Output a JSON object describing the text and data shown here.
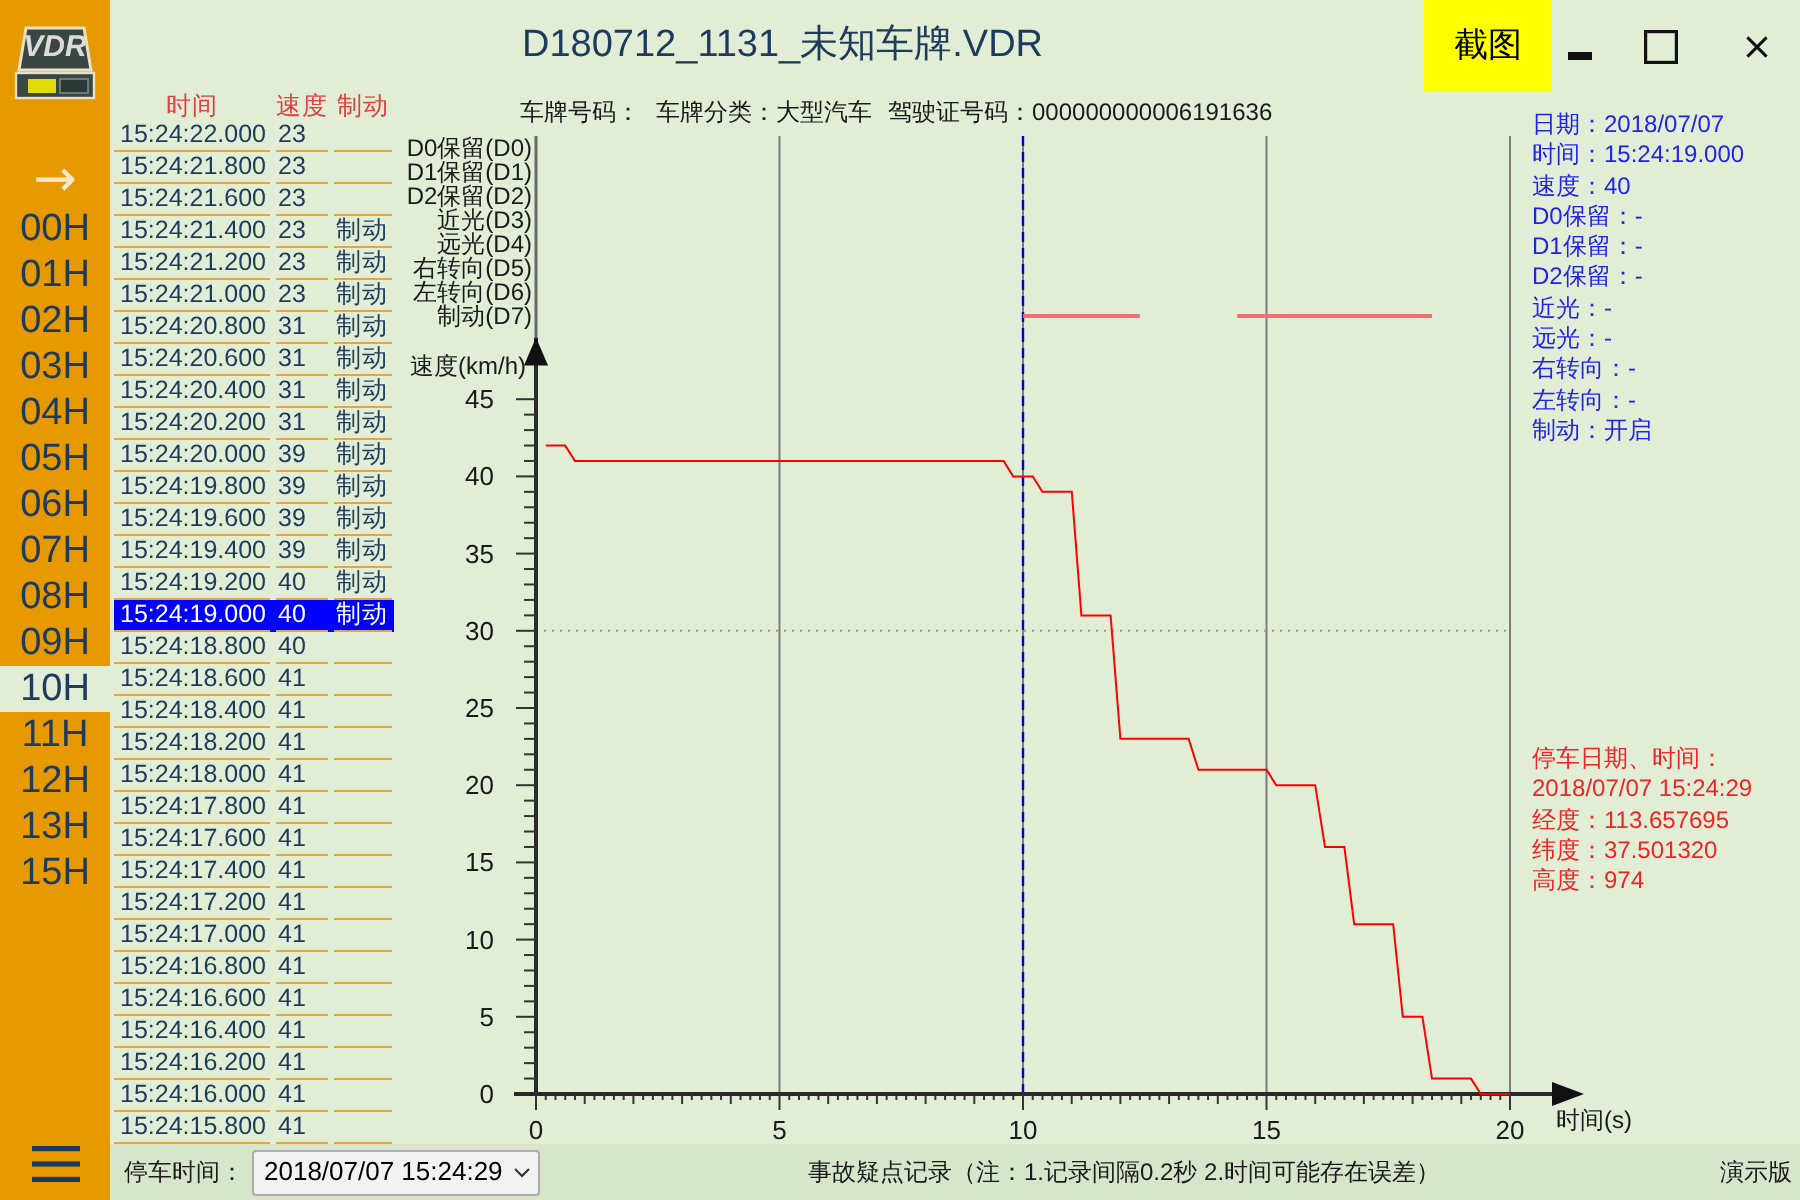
{
  "sidebar": {
    "logo_text": "VDR",
    "arrow": "→",
    "hours": [
      {
        "label": "00H",
        "selected": false
      },
      {
        "label": "01H",
        "selected": false
      },
      {
        "label": "02H",
        "selected": false
      },
      {
        "label": "03H",
        "selected": false
      },
      {
        "label": "04H",
        "selected": false
      },
      {
        "label": "05H",
        "selected": false
      },
      {
        "label": "06H",
        "selected": false
      },
      {
        "label": "07H",
        "selected": false
      },
      {
        "label": "08H",
        "selected": false
      },
      {
        "label": "09H",
        "selected": false
      },
      {
        "label": "10H",
        "selected": true
      },
      {
        "label": "11H",
        "selected": false
      },
      {
        "label": "12H",
        "selected": false
      },
      {
        "label": "13H",
        "selected": false
      },
      {
        "label": "15H",
        "selected": false
      }
    ]
  },
  "title_bar": {
    "title": "D180712_1131_未知车牌.VDR",
    "screenshot_button": "截图"
  },
  "record_list": {
    "columns": [
      "时间",
      "速度",
      "制动"
    ],
    "rows": [
      {
        "time": "15:24:22.000",
        "speed": "23",
        "selected": false
      },
      {
        "time": "15:24:21.800",
        "speed": "23",
        "selected": false
      },
      {
        "time": "15:24:21.600",
        "speed": "23",
        "selected": false
      },
      {
        "time": "15:24:21.400",
        "speed": "23",
        "brake": "制动",
        "selected": false
      },
      {
        "time": "15:24:21.200",
        "speed": "23",
        "brake": "制动",
        "selected": false
      },
      {
        "time": "15:24:21.000",
        "speed": "23",
        "brake": "制动",
        "selected": false
      },
      {
        "time": "15:24:20.800",
        "speed": "31",
        "brake": "制动",
        "selected": false
      },
      {
        "time": "15:24:20.600",
        "speed": "31",
        "brake": "制动",
        "selected": false
      },
      {
        "time": "15:24:20.400",
        "speed": "31",
        "brake": "制动",
        "selected": false
      },
      {
        "time": "15:24:20.200",
        "speed": "31",
        "brake": "制动",
        "selected": false
      },
      {
        "time": "15:24:20.000",
        "speed": "39",
        "brake": "制动",
        "selected": false
      },
      {
        "time": "15:24:19.800",
        "speed": "39",
        "brake": "制动",
        "selected": false
      },
      {
        "time": "15:24:19.600",
        "speed": "39",
        "brake": "制动",
        "selected": false
      },
      {
        "time": "15:24:19.400",
        "speed": "39",
        "brake": "制动",
        "selected": false
      },
      {
        "time": "15:24:19.200",
        "speed": "40",
        "brake": "制动",
        "selected": false
      },
      {
        "time": "15:24:19.000",
        "speed": "40",
        "brake": "制动",
        "selected": true
      },
      {
        "time": "15:24:18.800",
        "speed": "40",
        "selected": false
      },
      {
        "time": "15:24:18.600",
        "speed": "41",
        "selected": false
      },
      {
        "time": "15:24:18.400",
        "speed": "41",
        "selected": false
      },
      {
        "time": "15:24:18.200",
        "speed": "41",
        "selected": false
      },
      {
        "time": "15:24:18.000",
        "speed": "41",
        "selected": false
      },
      {
        "time": "15:24:17.800",
        "speed": "41",
        "selected": false
      },
      {
        "time": "15:24:17.600",
        "speed": "41",
        "selected": false
      },
      {
        "time": "15:24:17.400",
        "speed": "41",
        "selected": false
      },
      {
        "time": "15:24:17.200",
        "speed": "41",
        "selected": false
      },
      {
        "time": "15:24:17.000",
        "speed": "41",
        "selected": false
      },
      {
        "time": "15:24:16.800",
        "speed": "41",
        "selected": false
      },
      {
        "time": "15:24:16.600",
        "speed": "41",
        "selected": false
      },
      {
        "time": "15:24:16.400",
        "speed": "41",
        "selected": false
      },
      {
        "time": "15:24:16.200",
        "speed": "41",
        "selected": false
      },
      {
        "time": "15:24:16.000",
        "speed": "41",
        "selected": false
      },
      {
        "time": "15:24:15.800",
        "speed": "41",
        "selected": false
      }
    ]
  },
  "vehicle_info": [
    "车牌号码：",
    "车牌分类：大型汽车",
    "驾驶证号码：000000000006191636"
  ],
  "signal_lanes": [
    "D0保留(D0)",
    "D1保留(D1)",
    "D2保留(D2)",
    "近光(D3)",
    "远光(D4)",
    "右转向(D5)",
    "左转向(D6)",
    "制动(D7)"
  ],
  "chart": {
    "chart_data": {
      "type": "line",
      "xlabel": "时间(s)",
      "ylabel": "速度(km/h)",
      "xlim": [
        0,
        20
      ],
      "ylim": [
        0,
        49
      ],
      "xticks": [
        0,
        5,
        10,
        15,
        20
      ],
      "yticks": [
        0,
        5,
        10,
        15,
        20,
        25,
        30,
        35,
        40,
        45
      ],
      "grid": true,
      "x": [
        0.2,
        0.6,
        0.8,
        9.6,
        9.8,
        10.2,
        10.4,
        11.0,
        11.2,
        11.8,
        12.0,
        13.4,
        13.6,
        15.0,
        15.2,
        16.0,
        16.2,
        16.6,
        16.8,
        17.6,
        17.8,
        18.2,
        18.4,
        19.2,
        19.4,
        20.0
      ],
      "series": [
        {
          "color": "#ff0000",
          "values": [
            42,
            42,
            41,
            41,
            40,
            40,
            39,
            39,
            31,
            31,
            23,
            23,
            21,
            21,
            20,
            20,
            16,
            16,
            11,
            11,
            5,
            5,
            1,
            1,
            0,
            0
          ]
        }
      ],
      "ref_lines": [
        {
          "axis": "x",
          "value": 10
        },
        {
          "axis": "y",
          "value": 30
        }
      ]
    }
  },
  "current_record": [
    "日期：2018/07/07",
    "时间：15:24:19.000",
    "速度：40",
    "D0保留：-",
    "D1保留：-",
    "D2保留：-",
    "近光：-",
    "远光：-",
    "右转向：-",
    "左转向：-",
    "制动：开启"
  ],
  "stop_record": [
    "停车日期、时间：",
    "2018/07/07 15:24:29",
    "经度：113.657695",
    "纬度：37.501320",
    "高度：974"
  ],
  "status_bar": {
    "stop_time_label": "停车时间：",
    "stop_time_value": "2018/07/07 15:24:29",
    "note": "事故疑点记录（注：1.记录间隔0.2秒 2.时间可能存在误差）",
    "edition": "演示版"
  }
}
